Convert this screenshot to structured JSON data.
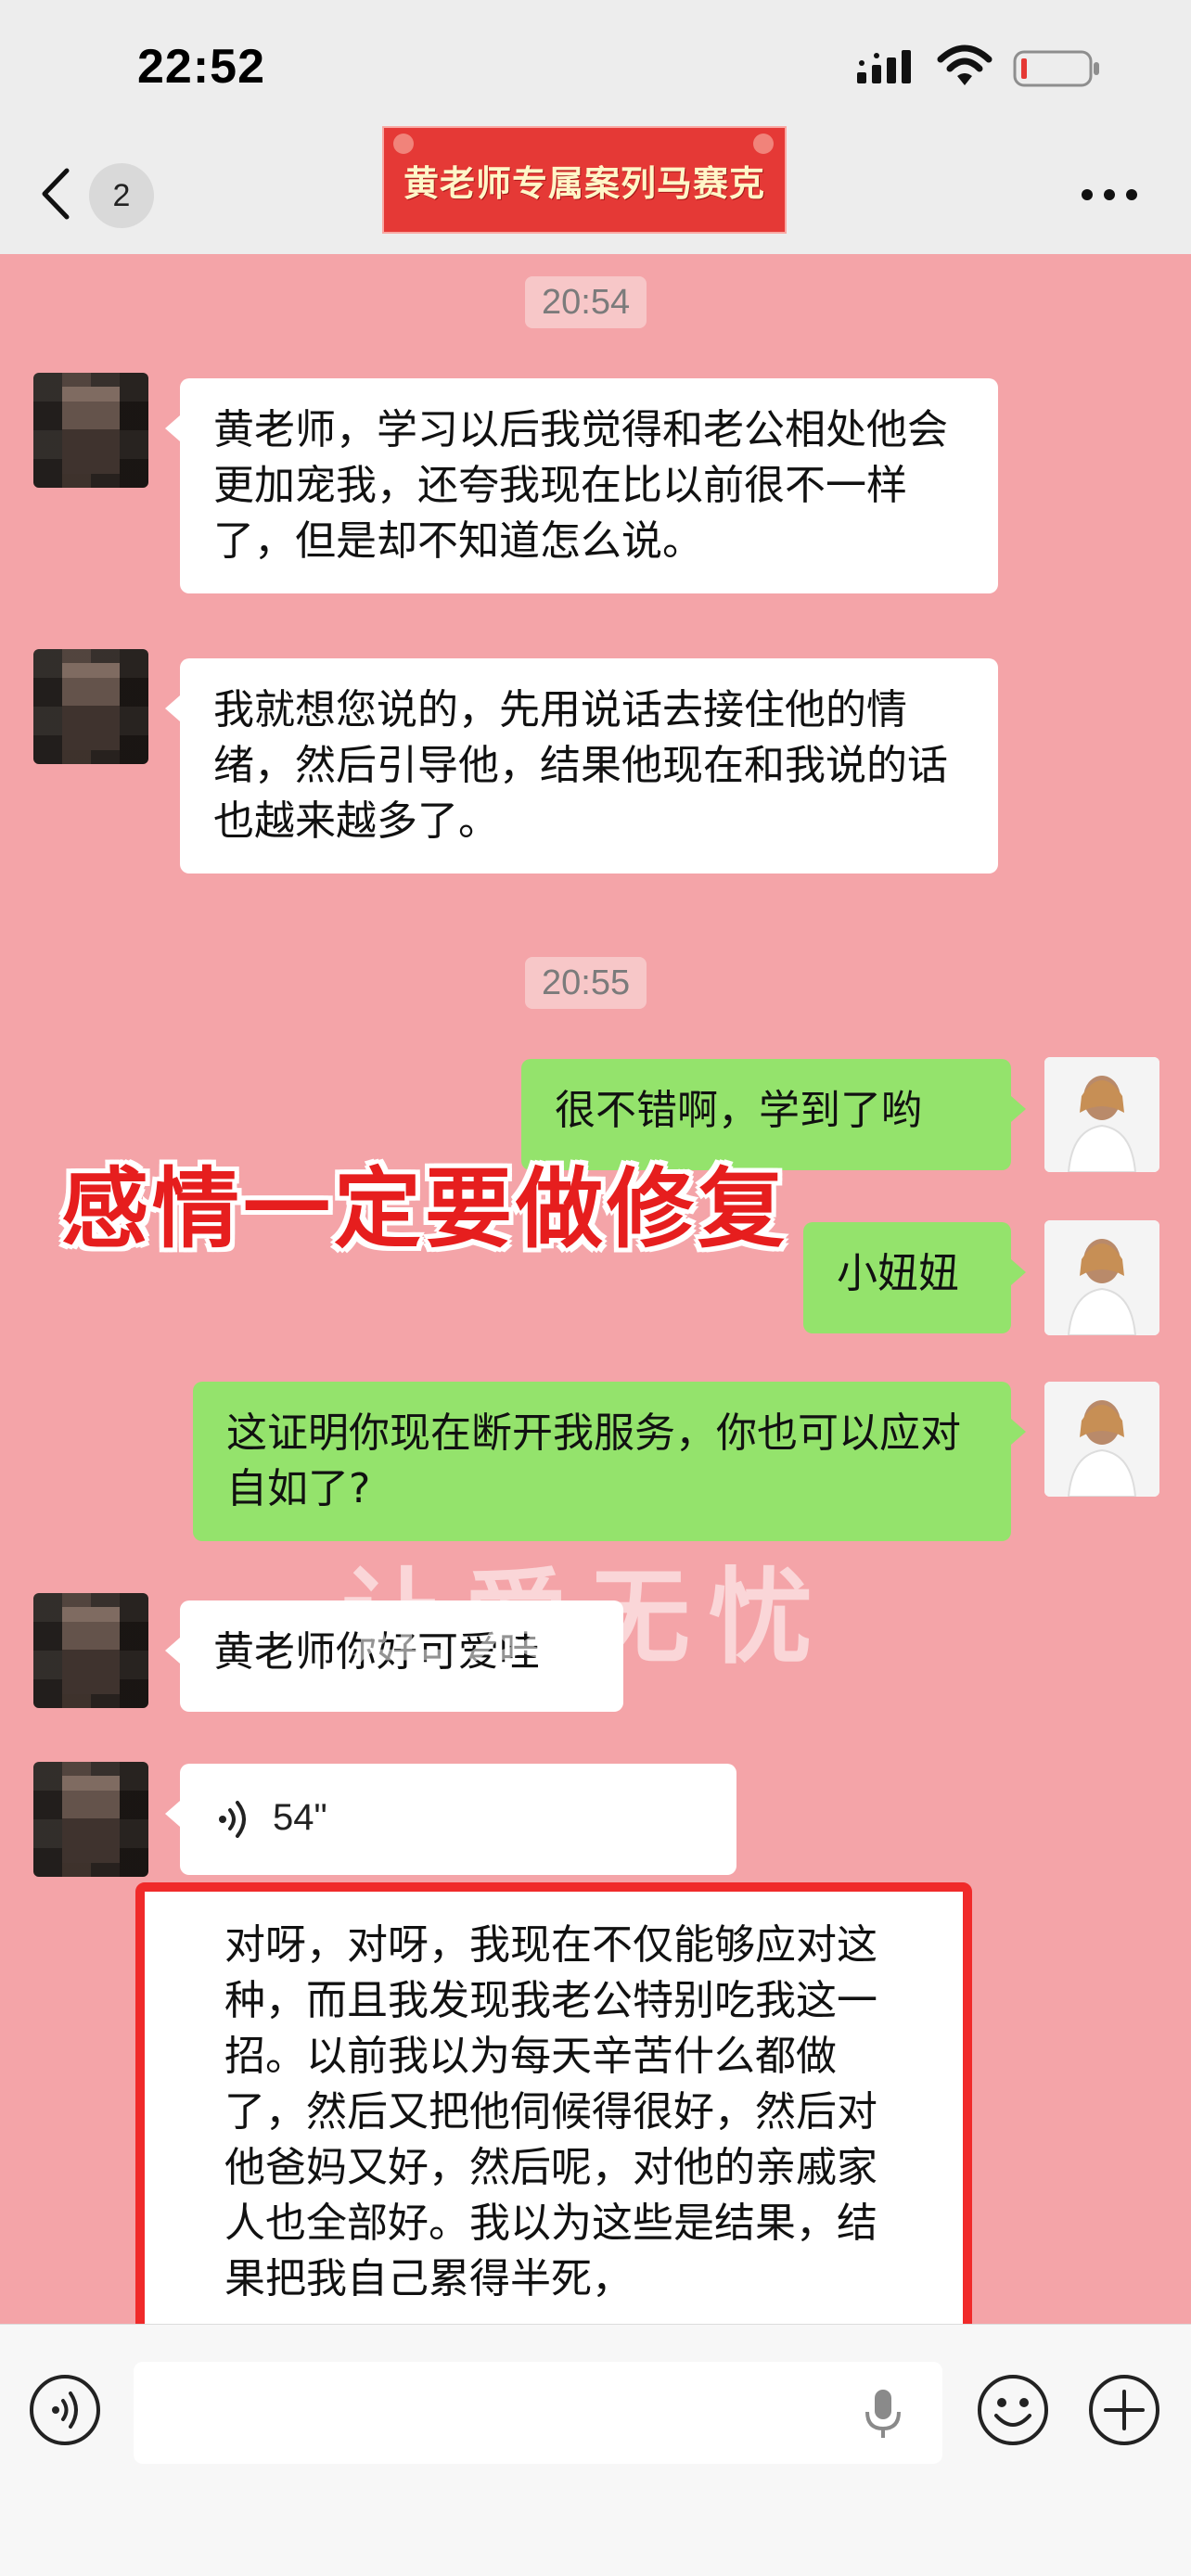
{
  "status_bar": {
    "time": "22:52"
  },
  "nav": {
    "unread_count": "2",
    "chat_title": "黄老师专属案列马赛克"
  },
  "messages": [
    {
      "type": "timestamp",
      "text": "20:54"
    },
    {
      "type": "text",
      "side": "left",
      "text": "黄老师，学习以后我觉得和老公相处他会更加宠我，还夸我现在比以前很不一样了，但是却不知道怎么说。"
    },
    {
      "type": "text",
      "side": "left",
      "text": "我就想您说的，先用说话去接住他的情绪，然后引导他，结果他现在和我说的话也越来越多了。"
    },
    {
      "type": "timestamp",
      "text": "20:55"
    },
    {
      "type": "text",
      "side": "right",
      "text": "很不错啊，学到了哟"
    },
    {
      "type": "text",
      "side": "right",
      "text": "小妞妞"
    },
    {
      "type": "text",
      "side": "right",
      "text": "这证明你现在断开我服务，你也可以应对自如了?"
    },
    {
      "type": "text",
      "side": "left",
      "text": "黄老师你好可爱哇"
    },
    {
      "type": "voice",
      "side": "left",
      "duration": "54\""
    },
    {
      "type": "text",
      "side": "left",
      "highlighted": true,
      "text": "对呀，对呀，我现在不仅能够应对这种，而且我发现我老公特别吃我这一招。以前我以为每天辛苦什么都做了，然后又把他伺候得很好，然后对他爸妈又好，然后呢，对他的亲戚家人也全部好。我以为这些是结果，结果把我自己累得半死，"
    }
  ],
  "overlay": {
    "caption": "感情一定要做修复",
    "watermark": "让爱无忧"
  },
  "colors": {
    "chat_background": "#f4a4a8",
    "self_bubble": "#94e36c",
    "other_bubble": "#ffffff",
    "highlight_border": "#f02a2a",
    "caption_red": "#e61e1e"
  },
  "icons": [
    "back-chevron-icon",
    "more-icon",
    "signal-icon",
    "wifi-icon",
    "battery-icon",
    "voice-icon",
    "voice-mode-icon",
    "microphone-icon",
    "emoji-icon",
    "plus-icon"
  ]
}
